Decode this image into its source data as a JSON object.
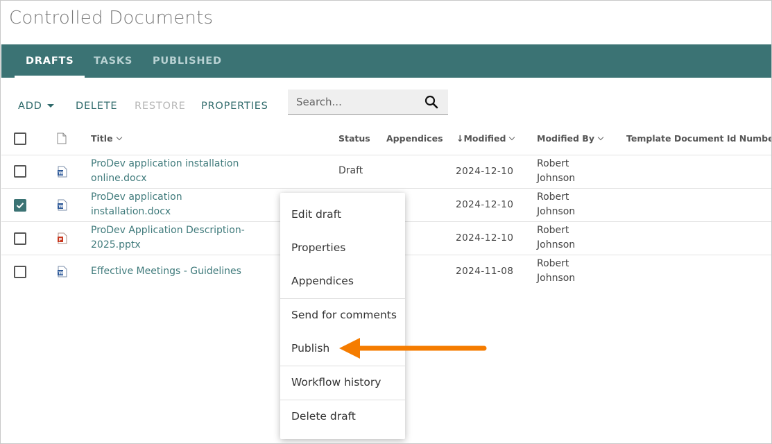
{
  "app": {
    "title": "Controlled Documents"
  },
  "tabs": [
    {
      "label": "DRAFTS",
      "active": true
    },
    {
      "label": "TASKS",
      "active": false
    },
    {
      "label": "PUBLISHED",
      "active": false
    }
  ],
  "toolbar": {
    "add_label": "ADD",
    "delete_label": "DELETE",
    "restore_label": "RESTORE",
    "properties_label": "PROPERTIES"
  },
  "search": {
    "placeholder": "Search..."
  },
  "table": {
    "columns": {
      "title": "Title",
      "status": "Status",
      "appendices": "Appendices",
      "modified": "↓Modified",
      "modified_by": "Modified By",
      "template_id": "Template Document Id Number"
    },
    "rows": [
      {
        "title_line1": "ProDev application installation",
        "title_line2": "online.docx",
        "file_type": "word",
        "status": "Draft",
        "appendices": "",
        "modified": "2024-12-10",
        "modified_by_1": "Robert",
        "modified_by_2": "Johnson",
        "selected": false
      },
      {
        "title_line1": "ProDev application",
        "title_line2": "installation.docx",
        "file_type": "word",
        "status": "",
        "appendices": "",
        "modified": "2024-12-10",
        "modified_by_1": "Robert",
        "modified_by_2": "Johnson",
        "selected": true
      },
      {
        "title_line1": "ProDev Application Description-",
        "title_line2": "2025.pptx",
        "file_type": "powerpoint",
        "status": "",
        "appendices": "",
        "modified": "2024-12-10",
        "modified_by_1": "Robert",
        "modified_by_2": "Johnson",
        "selected": false
      },
      {
        "title_line1": "Effective Meetings - Guidelines",
        "title_line2": "",
        "file_type": "word",
        "status": "",
        "appendices": "",
        "modified": "2024-11-08",
        "modified_by_1": "Robert",
        "modified_by_2": "Johnson",
        "selected": false
      }
    ]
  },
  "context_menu": {
    "items": [
      {
        "label": "Edit draft"
      },
      {
        "label": "Properties"
      },
      {
        "label": "Appendices"
      },
      {
        "label": "Send for comments"
      },
      {
        "label": "Publish"
      },
      {
        "label": "Workflow history"
      },
      {
        "label": "Delete draft"
      }
    ]
  },
  "colors": {
    "tab_bar": "#3b7374",
    "link": "#3f7a7b",
    "arrow": "#f57c00",
    "word_icon": "#2b5797",
    "powerpoint_icon": "#c9381f"
  }
}
